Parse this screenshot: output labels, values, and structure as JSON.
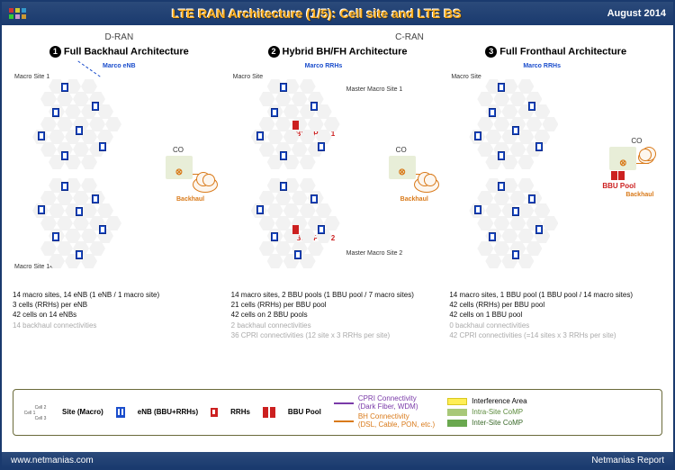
{
  "header": {
    "title": "LTE RAN Architecture (1/5): Cell site and LTE BS",
    "date": "August 2014"
  },
  "columns": [
    {
      "supertitle": "D-RAN",
      "number": "1",
      "title": "Full Backhaul Architecture",
      "labels": {
        "node_type": "Marco eNB",
        "site_top": "Macro Site 1",
        "site_bottom": "Macro Site 14",
        "co": "CO",
        "backhaul": "Backhaul"
      },
      "text": [
        "14 macro sites, 14 eNB (1 eNB / 1 macro site)",
        "3 cells (RRHs) per eNB",
        "42 cells on 14 eNBs"
      ],
      "text_grey": [
        "14 backhaul connectivities"
      ]
    },
    {
      "supertitle": "C-RAN",
      "number": "2",
      "title": "Hybrid BH/FH Architecture",
      "labels": {
        "node_type": "Marco RRHs",
        "site_top": "Macro Site",
        "master1": "Master Macro Site 1",
        "master2": "Master Macro Site 2",
        "bbu1": "BBU Pool 1",
        "bbu2": "BBU Pool 2",
        "co": "CO",
        "backhaul": "Backhaul"
      },
      "text": [
        "14 macro sites, 2 BBU pools (1 BBU pool / 7 macro sites)",
        "21 cells (RRHs) per BBU pool",
        "42 cells on 2 BBU pools"
      ],
      "text_grey": [
        "2 backhaul connectivities",
        "36 CPRI connectivities (12 site x 3 RRHs per site)"
      ]
    },
    {
      "supertitle": "",
      "number": "3",
      "title": "Full Fronthaul Architecture",
      "labels": {
        "node_type": "Marco RRHs",
        "site_top": "Macro Site",
        "bbu": "BBU Pool",
        "co": "CO",
        "backhaul": "Backhaul"
      },
      "text": [
        "14 macro sites, 1 BBU pool (1 BBU pool / 14 macro sites)",
        "42 cells (RRHs) per BBU pool",
        "42 cells on 1 BBU pool"
      ],
      "text_grey": [
        "0 backhaul connectivities",
        "42 CPRI connectivities (=14 sites x 3 RRHs per site)"
      ]
    }
  ],
  "legend": {
    "cell1": "Cell 1",
    "cell2": "Cell 2",
    "cell3": "Cell 3",
    "site": "Site (Macro)",
    "enb": "eNB (BBU+RRHs)",
    "rrhs": "RRHs",
    "bbu": "BBU Pool",
    "cpri1": "CPRI Connectivity",
    "cpri2": "(Dark Fiber, WDM)",
    "bh1": "BH Connectivity",
    "bh2": "(DSL, Cable, PON, etc.)",
    "interf": "Interference Area",
    "intra": "Intra-Site CoMP",
    "inter": "Inter-Site CoMP"
  },
  "footer": {
    "left": "www.netmanias.com",
    "right": "Netmanias Report"
  }
}
